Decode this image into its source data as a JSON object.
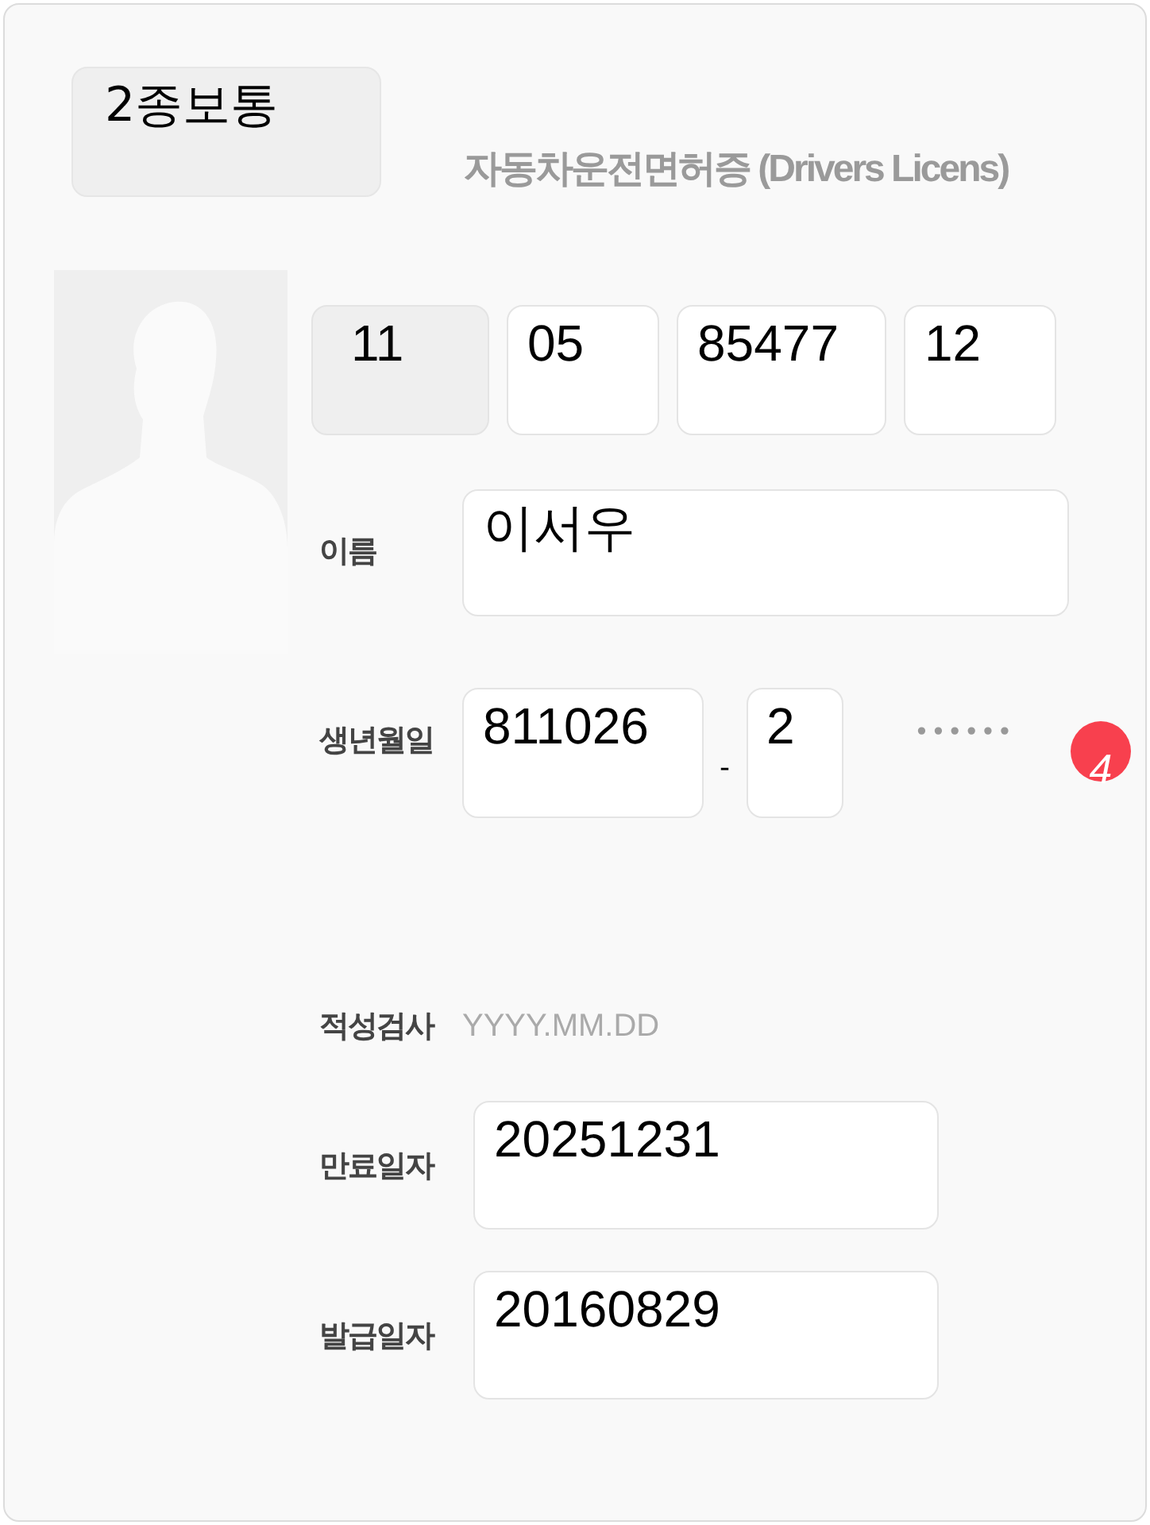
{
  "license_class": "2종보통",
  "card_title": "자동차운전면허증 (Drivers Licens)",
  "license_number": [
    {
      "value": "11",
      "disabled": true
    },
    {
      "value": "05",
      "disabled": false
    },
    {
      "value": "85477",
      "disabled": false
    },
    {
      "value": "12",
      "disabled": false
    }
  ],
  "name": {
    "label": "이름",
    "value": "이서우"
  },
  "birth_date": {
    "label": "생년월일",
    "front": "811026",
    "separator": "-",
    "back": "2",
    "masked": "••••••",
    "badge": "4"
  },
  "aptitude_test": {
    "label": "적성검사",
    "placeholder": "YYYY.MM.DD"
  },
  "expiry_date": {
    "label": "만료일자",
    "value": "20251231"
  },
  "issue_date": {
    "label": "발급일자",
    "value": "20160829"
  }
}
